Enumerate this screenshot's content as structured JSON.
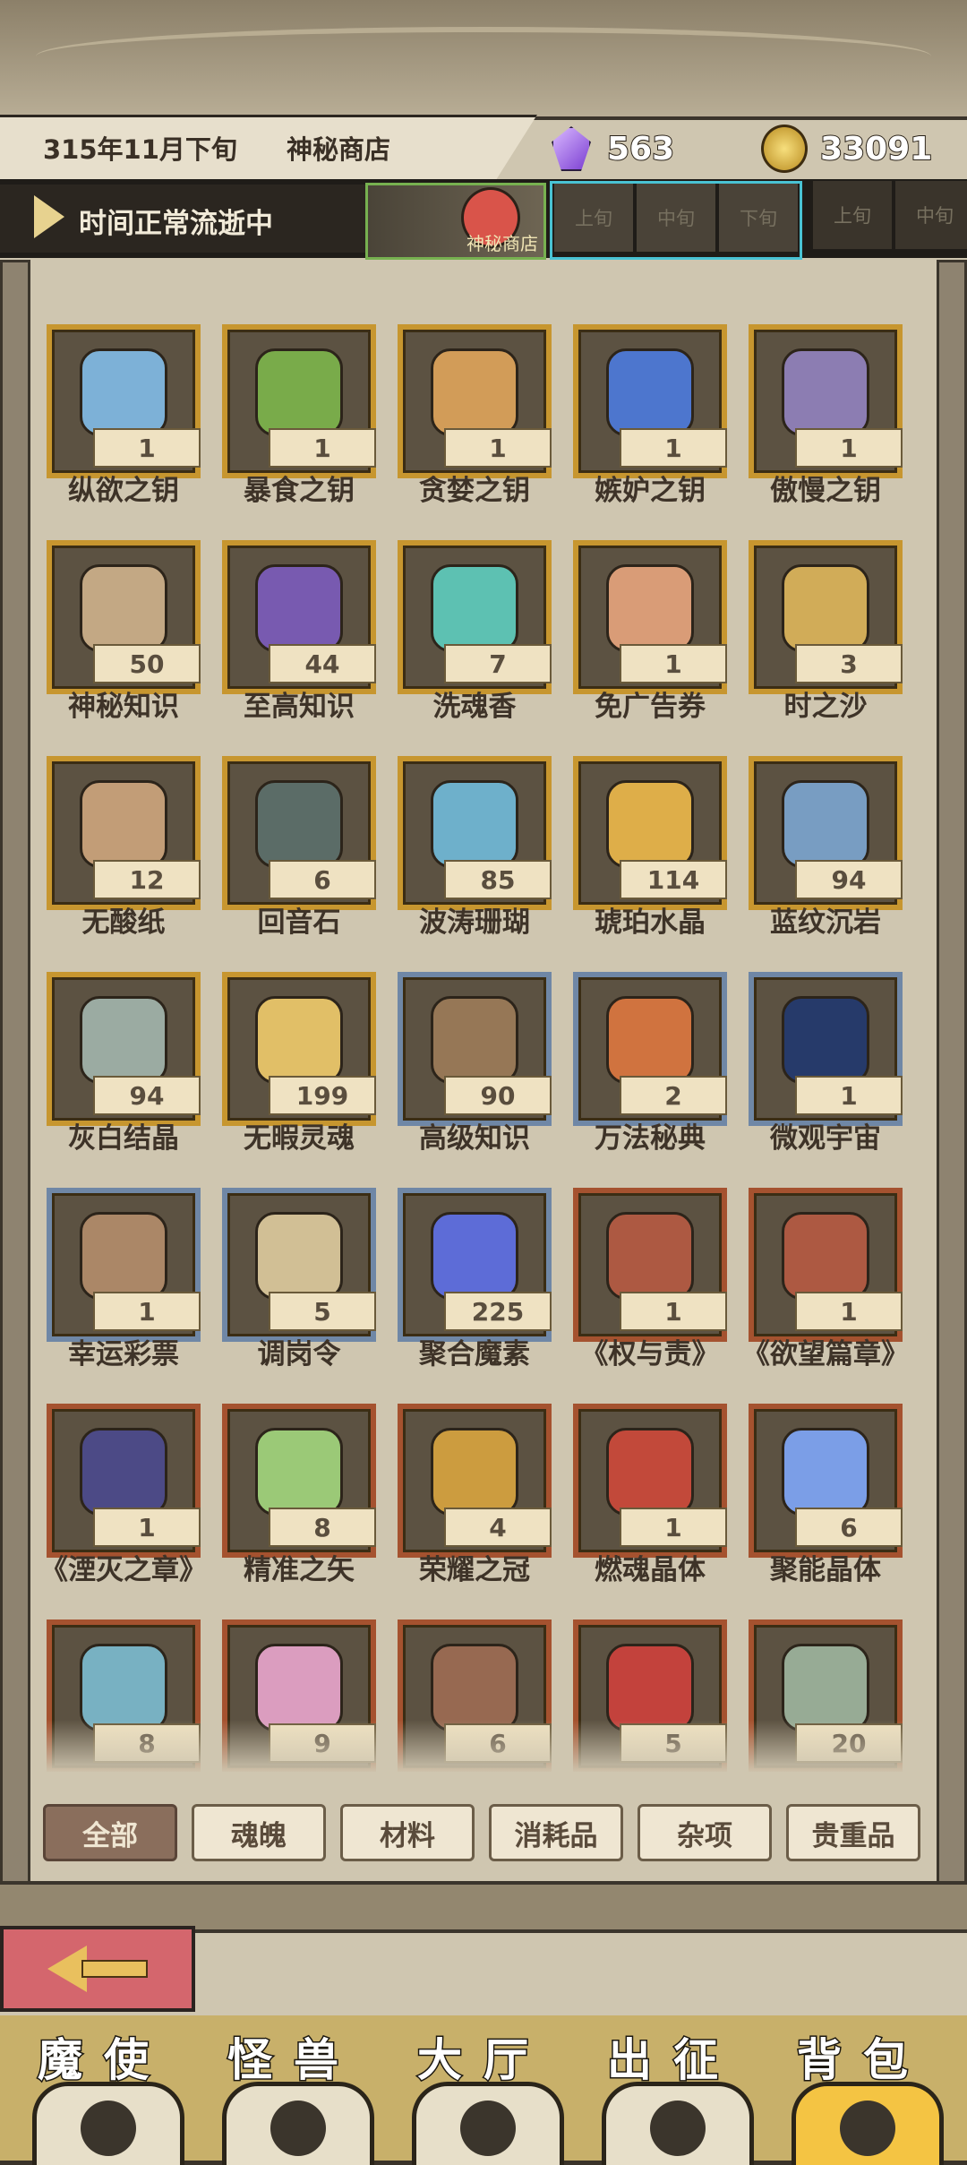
{
  "header": {
    "date": "315年11月下旬",
    "shop": "神秘商店",
    "gems": "563",
    "coins": "33091",
    "time_status": "时间正常流逝中",
    "shop_thumb_label": "神秘商店",
    "periods_current": [
      "上旬",
      "中旬",
      "下旬"
    ],
    "periods_next": [
      "上旬",
      "中旬"
    ]
  },
  "items": [
    {
      "name": "纵欲之钥",
      "count": "1",
      "color": "#7fb7df",
      "frame": "gold"
    },
    {
      "name": "暴食之钥",
      "count": "1",
      "color": "#7bb04b",
      "frame": "gold"
    },
    {
      "name": "贪婪之钥",
      "count": "1",
      "color": "#d9a05a",
      "frame": "gold"
    },
    {
      "name": "嫉妒之钥",
      "count": "1",
      "color": "#4d78d6",
      "frame": "gold"
    },
    {
      "name": "傲慢之钥",
      "count": "1",
      "color": "#8f80b8",
      "frame": "gold"
    },
    {
      "name": "神秘知识",
      "count": "50",
      "color": "#c9ad88",
      "frame": "gold"
    },
    {
      "name": "至高知识",
      "count": "44",
      "color": "#7a5bb6",
      "frame": "gold"
    },
    {
      "name": "洗魂香",
      "count": "7",
      "color": "#5ec7b8",
      "frame": "gold"
    },
    {
      "name": "免广告券",
      "count": "1",
      "color": "#e0a07a",
      "frame": "gold"
    },
    {
      "name": "时之沙",
      "count": "3",
      "color": "#d8b15a",
      "frame": "gold"
    },
    {
      "name": "无酸纸",
      "count": "12",
      "color": "#c8a27a",
      "frame": "gold"
    },
    {
      "name": "回音石",
      "count": "6",
      "color": "#5b6e6a",
      "frame": "gold"
    },
    {
      "name": "波涛珊瑚",
      "count": "85",
      "color": "#6fb6d3",
      "frame": "gold"
    },
    {
      "name": "琥珀水晶",
      "count": "114",
      "color": "#e6b34a",
      "frame": "gold"
    },
    {
      "name": "蓝纹沉岩",
      "count": "94",
      "color": "#7aa2c9",
      "frame": "gold"
    },
    {
      "name": "灰白结晶",
      "count": "94",
      "color": "#9fb0a8",
      "frame": "gold"
    },
    {
      "name": "无暇灵魂",
      "count": "199",
      "color": "#e9c56a",
      "frame": "gold"
    },
    {
      "name": "高级知识",
      "count": "90",
      "color": "#9a7a58",
      "frame": "silver"
    },
    {
      "name": "万法秘典",
      "count": "2",
      "color": "#d7753f",
      "frame": "silver"
    },
    {
      "name": "微观宇宙",
      "count": "1",
      "color": "#24396d",
      "frame": "silver"
    },
    {
      "name": "幸运彩票",
      "count": "1",
      "color": "#b08a6a",
      "frame": "silver"
    },
    {
      "name": "调岗令",
      "count": "5",
      "color": "#d8c59a",
      "frame": "silver"
    },
    {
      "name": "聚合魔素",
      "count": "225",
      "color": "#5e6ee0",
      "frame": "silver"
    },
    {
      "name": "《权与责》",
      "count": "1",
      "color": "#b25a43",
      "frame": "copper"
    },
    {
      "name": "《欲望篇章》",
      "count": "1",
      "color": "#b25a43",
      "frame": "copper"
    },
    {
      "name": "《湮灭之章》",
      "count": "1",
      "color": "#4c4a8a",
      "frame": "copper"
    },
    {
      "name": "精准之矢",
      "count": "8",
      "color": "#9fd07a",
      "frame": "copper"
    },
    {
      "name": "荣耀之冠",
      "count": "4",
      "color": "#d3a13f",
      "frame": "copper"
    },
    {
      "name": "燃魂晶体",
      "count": "1",
      "color": "#c8493a",
      "frame": "copper"
    },
    {
      "name": "聚能晶体",
      "count": "6",
      "color": "#7da3f0",
      "frame": "copper"
    },
    {
      "name": "",
      "count": "8",
      "color": "#7ab7c9",
      "frame": "copper"
    },
    {
      "name": "",
      "count": "9",
      "color": "#e2a2c6",
      "frame": "copper"
    },
    {
      "name": "",
      "count": "6",
      "color": "#9b6b52",
      "frame": "copper"
    },
    {
      "name": "",
      "count": "5",
      "color": "#c9423c",
      "frame": "copper"
    },
    {
      "name": "",
      "count": "20",
      "color": "#9bb09a",
      "frame": "copper"
    }
  ],
  "filters": {
    "all": "全部",
    "soul": "魂魄",
    "material": "材料",
    "consumable": "消耗品",
    "misc": "杂项",
    "valuable": "贵重品"
  },
  "nav": {
    "demon": "魔使",
    "monster": "怪兽",
    "lobby": "大厅",
    "expedition": "出征",
    "backpack": "背包"
  }
}
